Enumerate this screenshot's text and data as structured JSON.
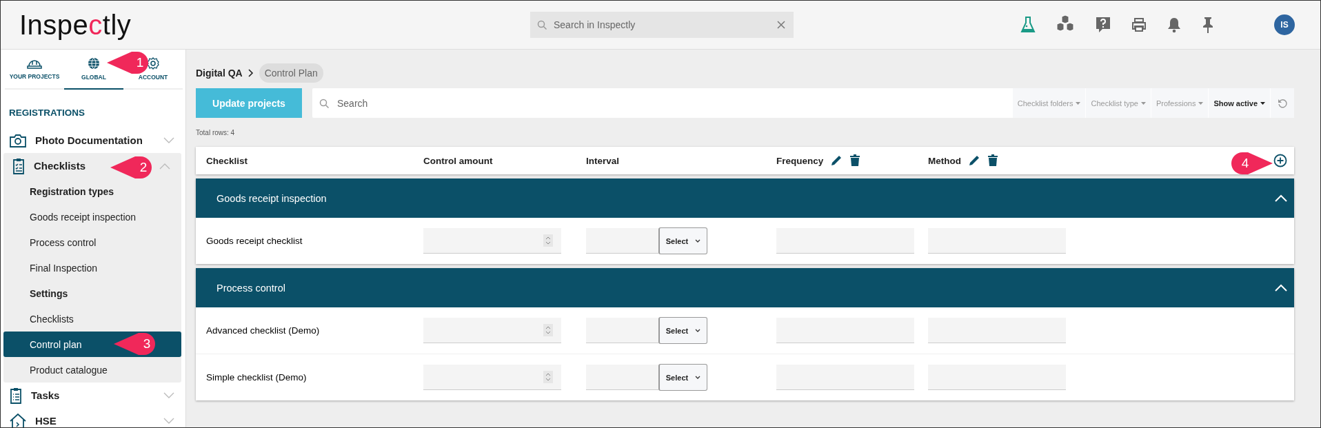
{
  "header": {
    "logo": [
      {
        "text": "Inspe",
        "accent": false
      },
      {
        "text": "c",
        "accent": true
      },
      {
        "text": "tly",
        "accent": false
      }
    ],
    "search": {
      "placeholder": "Search in Inspectly"
    },
    "tools": [
      {
        "kind": "flask"
      },
      {
        "kind": "cubes"
      },
      {
        "kind": "help"
      },
      {
        "kind": "print"
      },
      {
        "kind": "bell"
      },
      {
        "kind": "pin"
      }
    ],
    "avatar": "IS"
  },
  "sidebar": {
    "tabs": [
      {
        "label": "YOUR PROJECTS",
        "kind": "helmet",
        "selected": false
      },
      {
        "label": "GLOBAL",
        "kind": "globe",
        "selected": true
      },
      {
        "label": "ACCOUNT",
        "kind": "gear",
        "selected": false
      }
    ],
    "section": "REGISTRATIONS",
    "items": [
      {
        "label": "Photo Documentation",
        "kind": "camera",
        "expanded": false
      },
      {
        "label": "Checklists",
        "kind": "clipboard",
        "expanded": true,
        "children": [
          {
            "label": "Registration types",
            "kind": "heading"
          },
          {
            "label": "Goods receipt inspection",
            "kind": "link",
            "selected": false
          },
          {
            "label": "Process control",
            "kind": "link",
            "selected": false
          },
          {
            "label": "Final Inspection",
            "kind": "link",
            "selected": false
          },
          {
            "label": "Settings",
            "kind": "heading"
          },
          {
            "label": "Checklists",
            "kind": "link",
            "selected": false
          },
          {
            "label": "Control plan",
            "kind": "link",
            "selected": true
          },
          {
            "label": "Product catalogue",
            "kind": "link",
            "selected": false
          }
        ]
      },
      {
        "label": "Tasks",
        "kind": "list",
        "expanded": false
      },
      {
        "label": "HSE",
        "kind": "house",
        "expanded": false
      }
    ]
  },
  "main": {
    "breadcrumb": [
      "Digital QA",
      "Control Plan"
    ],
    "update_button": "Update projects",
    "search": {
      "placeholder": "Search"
    },
    "filters": [
      {
        "label": "Checklist folders",
        "active": false
      },
      {
        "label": "Checklist type",
        "active": false
      },
      {
        "label": "Professions",
        "active": false
      },
      {
        "label": "Show active",
        "active": true
      }
    ],
    "total": "Total rows: 4",
    "columns": [
      {
        "label": "Checklist",
        "actions": false
      },
      {
        "label": "Control amount",
        "actions": false
      },
      {
        "label": "Interval",
        "actions": false
      },
      {
        "label": "Frequency",
        "actions": true
      },
      {
        "label": "Method",
        "actions": true
      }
    ],
    "groups": [
      {
        "title": "Goods receipt inspection",
        "expanded": true,
        "rows": [
          {
            "name": "Goods receipt checklist",
            "interval_select": "Select"
          }
        ]
      },
      {
        "title": "Process control",
        "expanded": true,
        "rows": [
          {
            "name": "Advanced checklist (Demo)",
            "interval_select": "Select"
          },
          {
            "name": "Simple checklist (Demo)",
            "interval_select": "Select"
          }
        ]
      }
    ]
  },
  "callouts": [
    {
      "label": "1",
      "kind": "left"
    },
    {
      "label": "2",
      "kind": "left"
    },
    {
      "label": "3",
      "kind": "left"
    },
    {
      "label": "4",
      "kind": "right"
    }
  ]
}
